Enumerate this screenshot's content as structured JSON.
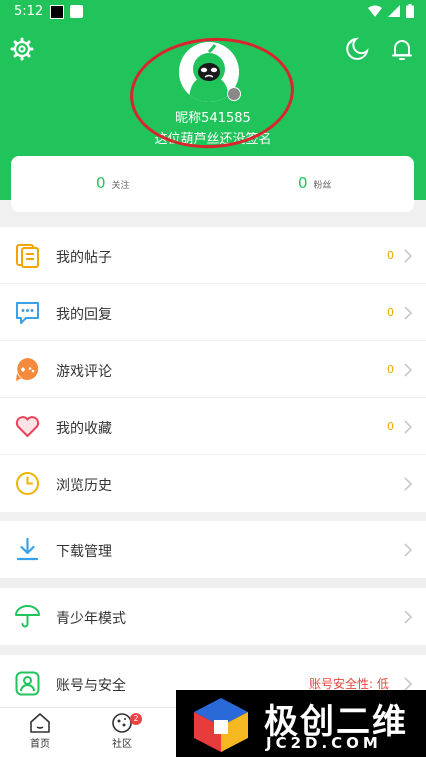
{
  "status_bar": {
    "time": "5:12"
  },
  "profile": {
    "nickname": "昵称541585",
    "signature": "这位葫芦丝还没签名"
  },
  "follow": {
    "following_count": "0",
    "following_label": "关注",
    "followers_count": "0",
    "followers_label": "粉丝"
  },
  "menu": {
    "my_posts": {
      "label": "我的帖子",
      "count": "0"
    },
    "my_replies": {
      "label": "我的回复",
      "count": "0"
    },
    "game_reviews": {
      "label": "游戏评论",
      "count": "0"
    },
    "my_favorites": {
      "label": "我的收藏",
      "count": "0"
    },
    "browse_history": {
      "label": "浏览历史"
    },
    "download_manager": {
      "label": "下载管理"
    },
    "teen_mode": {
      "label": "青少年模式"
    },
    "account_security": {
      "label": "账号与安全",
      "status": "账号安全性: 低"
    }
  },
  "tabs": {
    "home": "首页",
    "community": "社区",
    "community_badge": "2"
  },
  "watermark": {
    "main": "极创二维",
    "sub": "JC2D.COM"
  },
  "colors": {
    "brand": "#21c35b",
    "warning": "#f0a500",
    "danger": "#e8453c"
  }
}
